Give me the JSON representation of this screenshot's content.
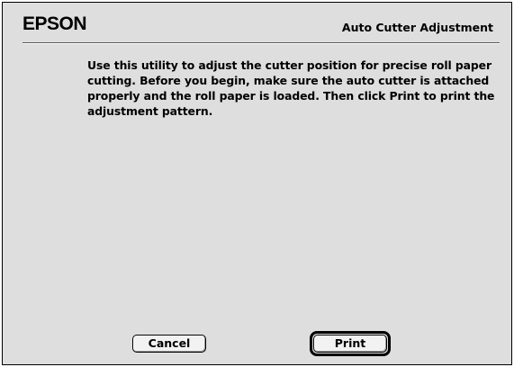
{
  "header": {
    "brand": "EPSON",
    "title": "Auto Cutter Adjustment"
  },
  "main": {
    "instructions": "Use this utility to adjust the cutter position for precise roll paper cutting. Before you begin, make sure the auto cutter is attached properly and the roll paper is loaded. Then click Print to print the adjustment pattern."
  },
  "buttons": {
    "cancel_label": "Cancel",
    "print_label": "Print"
  }
}
